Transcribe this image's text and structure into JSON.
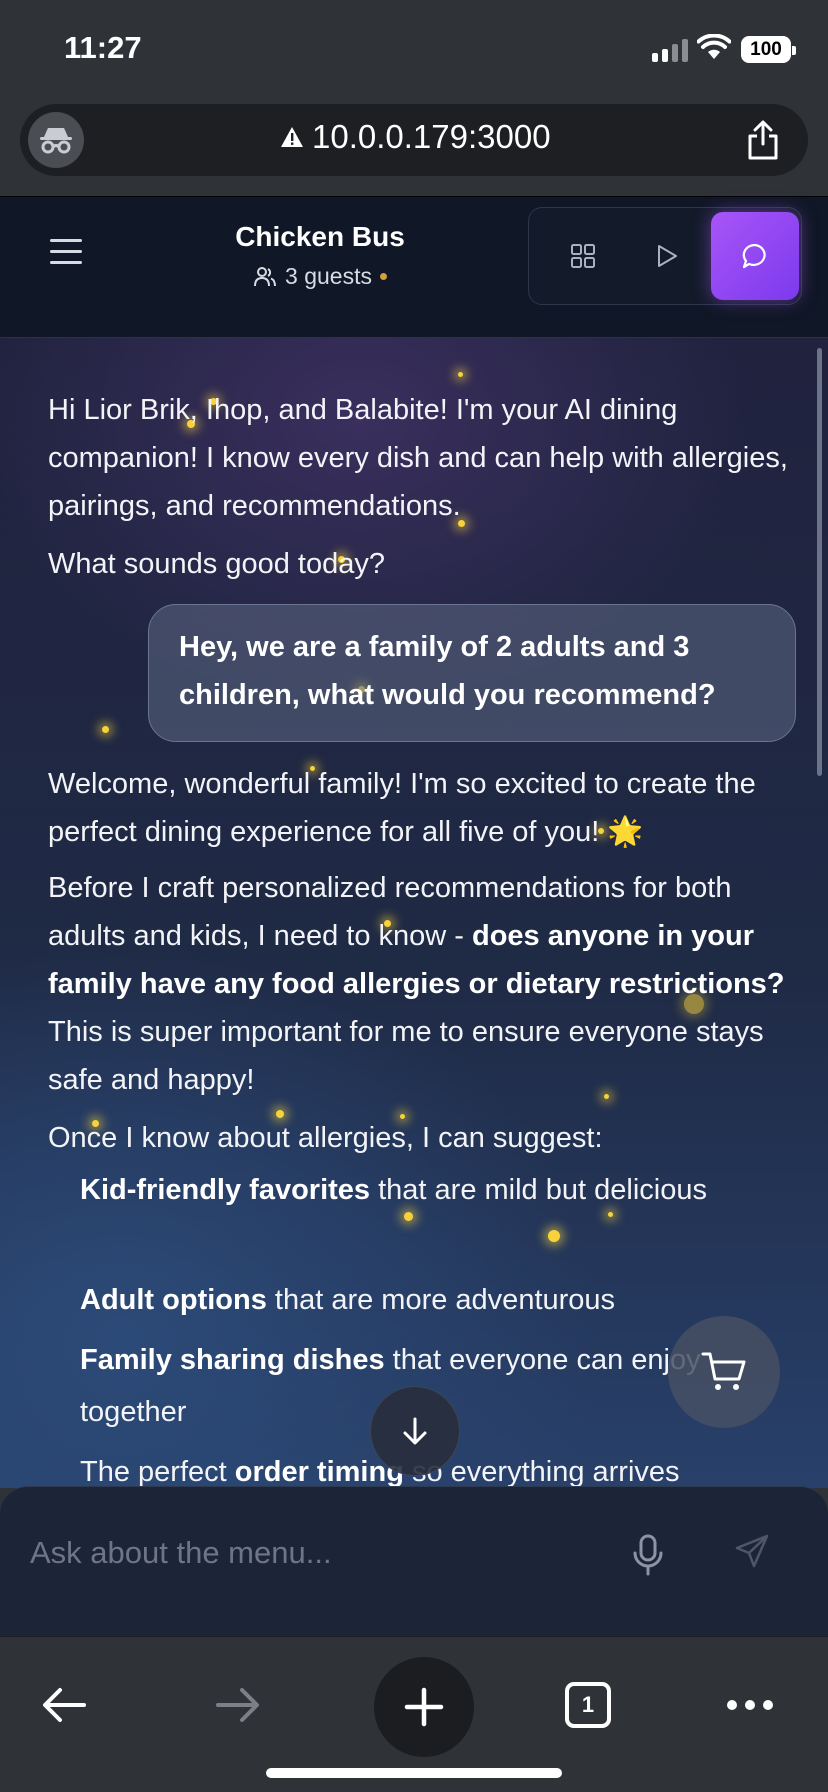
{
  "status": {
    "time": "11:27",
    "battery": "100"
  },
  "browser": {
    "url": "10.0.0.179:3000",
    "tab_count": "1"
  },
  "header": {
    "title": "Chicken Bus",
    "guests": "3 guests"
  },
  "chat": {
    "intro_1": "Hi Lior Brik, Ihop, and Balabite! I'm your AI dining companion! I know every dish and can help with allergies, pairings, and recommendations.",
    "intro_2": "What sounds good today?",
    "user_message": "Hey, we are a family of 2 adults and 3 children, what would you recommend?",
    "reply_welcome": "Welcome, wonderful family! I'm so excited to create the perfect dining experience for all five of you! 🌟",
    "reply_before": "Before I craft personalized recommendations for both adults and kids, I need to know - ",
    "reply_bold_question": "does anyone in your family have any food allergies or dietary restrictions?",
    "reply_after": " This is super important for me to ensure everyone stays safe and happy!",
    "reply_once": "Once I know about allergies, I can suggest:",
    "suggestions": [
      {
        "bold": "Kid-friendly favorites",
        "rest": " that are mild but delicious"
      },
      {
        "bold": "Adult options",
        "rest": " that are more adventurous"
      },
      {
        "bold": "Family sharing dishes",
        "rest": " that everyone can enjoy together"
      },
      {
        "pre": "The perfect ",
        "bold": "order timing",
        "rest": " so everything arrives"
      }
    ]
  },
  "composer": {
    "placeholder": "Ask about the menu..."
  },
  "colors": {
    "accent": "#a855f7",
    "header_bg": "#101726",
    "status_dot": "#d4a037"
  }
}
